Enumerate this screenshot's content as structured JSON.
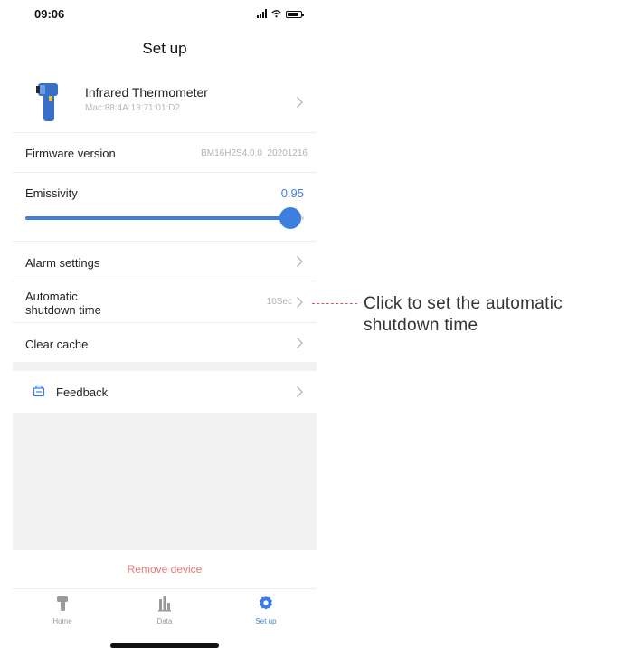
{
  "status_bar": {
    "time": "09:06"
  },
  "page": {
    "title": "Set up"
  },
  "device": {
    "name": "Infrared Thermometer",
    "mac": "Mac:88:4A:18:71:01:D2",
    "icon": "thermometer-gun-icon"
  },
  "settings": {
    "firmware": {
      "label": "Firmware version",
      "value": "BM16H2S4.0.0_20201216"
    },
    "emissivity": {
      "label": "Emissivity",
      "value": "0.95",
      "slider_level": 0.95,
      "accent_color": "#3d7fe0"
    },
    "alarm": {
      "label": "Alarm settings"
    },
    "shutdown": {
      "label_line1": "Automatic",
      "label_line2": "shutdown time",
      "value": "10Sec"
    },
    "cache": {
      "label": "Clear cache"
    },
    "feedback": {
      "label": "Feedback",
      "icon": "feedback-icon"
    }
  },
  "actions": {
    "remove_device": "Remove device",
    "remove_color": "#e27a74"
  },
  "tabs": [
    {
      "label": "Home",
      "icon": "thermometer-gun-icon",
      "active": false
    },
    {
      "label": "Data",
      "icon": "bar-chart-icon",
      "active": false
    },
    {
      "label": "Set up",
      "icon": "gear-icon",
      "active": true
    }
  ],
  "annotation": {
    "text": "Click to set the automatic shutdown time",
    "line_color": "#e05555"
  }
}
